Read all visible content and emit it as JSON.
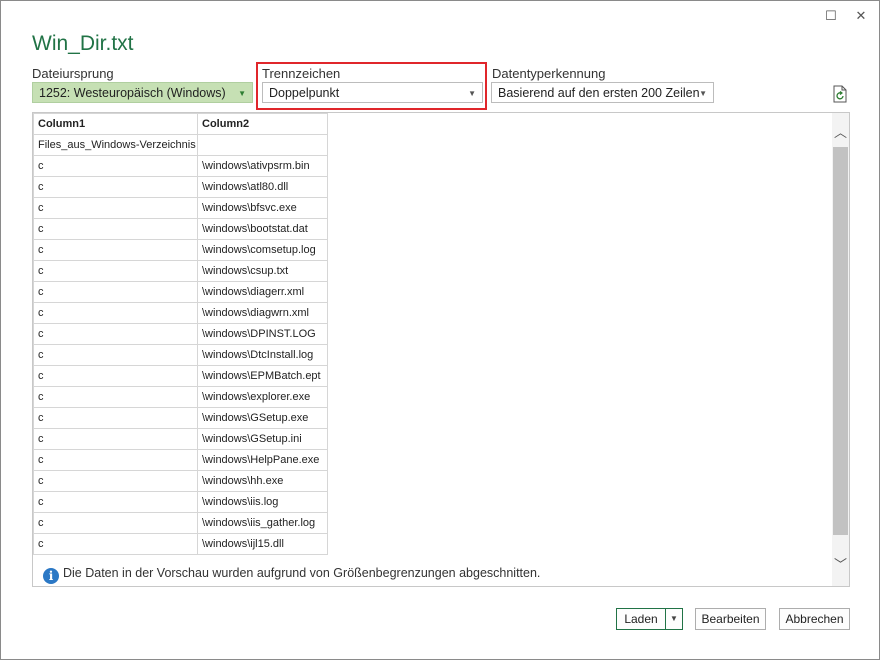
{
  "window": {
    "title": "Win_Dir.txt",
    "maximize_glyph": "☐",
    "close_glyph": "✕"
  },
  "controls": {
    "file_origin": {
      "label": "Dateiursprung",
      "value": "1252: Westeuropäisch (Windows)"
    },
    "delimiter": {
      "label": "Trennzeichen",
      "value": "Doppelpunkt"
    },
    "datatype": {
      "label": "Datentyperkennung",
      "value": "Basierend auf den ersten 200 Zeilen"
    },
    "dropdown_arrow": "▼"
  },
  "table": {
    "headers": [
      "Column1",
      "Column2"
    ],
    "rows": [
      [
        "Files_aus_Windows-Verzeichnis",
        ""
      ],
      [
        "c",
        "\\windows\\ativpsrm.bin"
      ],
      [
        "c",
        "\\windows\\atl80.dll"
      ],
      [
        "c",
        "\\windows\\bfsvc.exe"
      ],
      [
        "c",
        "\\windows\\bootstat.dat"
      ],
      [
        "c",
        "\\windows\\comsetup.log"
      ],
      [
        "c",
        "\\windows\\csup.txt"
      ],
      [
        "c",
        "\\windows\\diagerr.xml"
      ],
      [
        "c",
        "\\windows\\diagwrn.xml"
      ],
      [
        "c",
        "\\windows\\DPINST.LOG"
      ],
      [
        "c",
        "\\windows\\DtcInstall.log"
      ],
      [
        "c",
        "\\windows\\EPMBatch.ept"
      ],
      [
        "c",
        "\\windows\\explorer.exe"
      ],
      [
        "c",
        "\\windows\\GSetup.exe"
      ],
      [
        "c",
        "\\windows\\GSetup.ini"
      ],
      [
        "c",
        "\\windows\\HelpPane.exe"
      ],
      [
        "c",
        "\\windows\\hh.exe"
      ],
      [
        "c",
        "\\windows\\iis.log"
      ],
      [
        "c",
        "\\windows\\iis_gather.log"
      ],
      [
        "c",
        "\\windows\\ijl15.dll"
      ]
    ]
  },
  "scrollbar": {
    "up_glyph": "︿",
    "down_glyph": "﹀"
  },
  "info": {
    "icon_glyph": "i",
    "text": "Die Daten in der Vorschau wurden aufgrund von Größenbegrenzungen abgeschnitten."
  },
  "buttons": {
    "load": "Laden",
    "load_split_glyph": "▼",
    "edit": "Bearbeiten",
    "cancel": "Abbrechen"
  },
  "colors": {
    "accent": "#217346",
    "highlight": "#e0262b",
    "info_icon": "#2b78c5"
  }
}
